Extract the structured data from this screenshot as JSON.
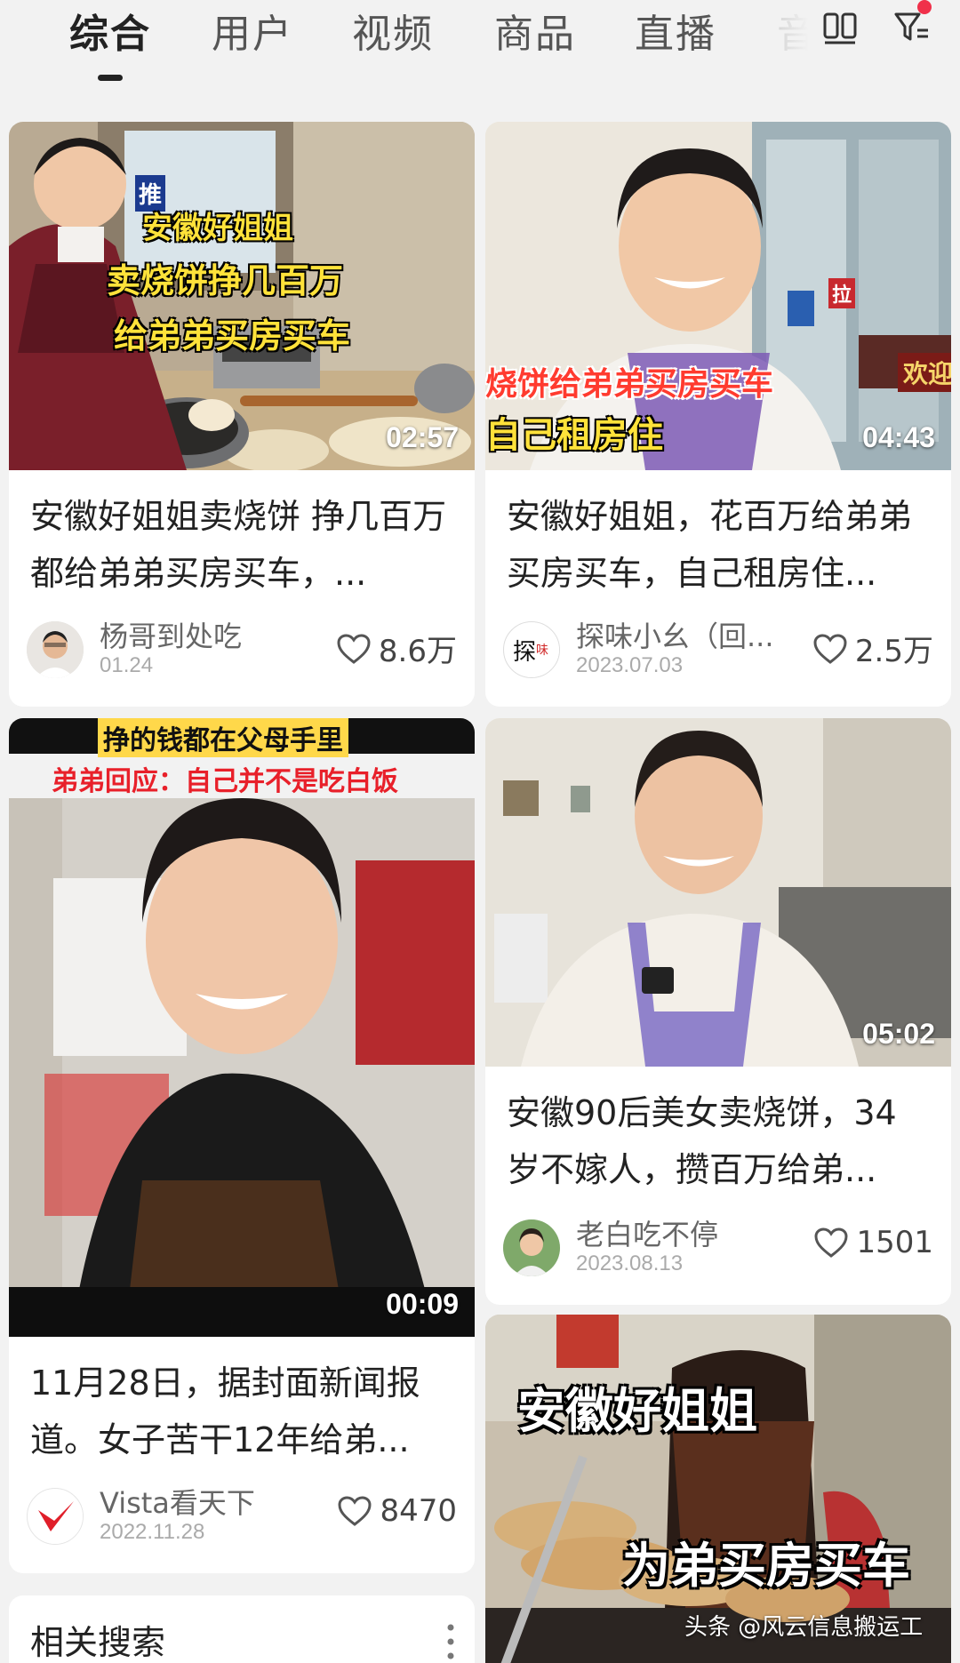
{
  "tabs": [
    {
      "label": "综合",
      "active": true
    },
    {
      "label": "用户",
      "active": false
    },
    {
      "label": "视频",
      "active": false
    },
    {
      "label": "商品",
      "active": false
    },
    {
      "label": "直播",
      "active": false
    },
    {
      "label": "音",
      "active": false
    }
  ],
  "icons": {
    "layout": "grid-layout-icon",
    "filter": "filter-icon",
    "like": "heart-icon",
    "more": "more-vertical-icon"
  },
  "colors": {
    "accent_red": "#f0304a",
    "caption_yellow": "#ffe23a",
    "caption_red": "#e8202a"
  },
  "cards": [
    {
      "duration": "02:57",
      "captions": [
        "推",
        "安徽好姐姐",
        "卖烧饼挣几百万",
        "给弟弟买房买车"
      ],
      "title": "安徽好姐姐卖烧饼 挣几百万都给弟弟买房买车，...",
      "author": "杨哥到处吃",
      "date": "01.24",
      "likes": "8.6万"
    },
    {
      "duration": "04:43",
      "captions": [
        "烧饼给弟弟买房买车",
        "自己租房住",
        "欢迎",
        "拉"
      ],
      "title": "安徽好姐姐，花百万给弟弟买房买车，自己租房住...",
      "author": "探味小幺（回...",
      "date": "2023.07.03",
      "likes": "2.5万"
    },
    {
      "duration": "00:09",
      "captions": [
        "挣的钱都在父母手里",
        "弟弟回应：自己并不是吃白饭"
      ],
      "title": "11月28日，据封面新闻报道。女子苦干12年给弟...",
      "author": "Vista看天下",
      "date": "2022.11.28",
      "likes": "8470"
    },
    {
      "duration": "05:02",
      "captions": [],
      "title": "安徽90后美女卖烧饼，34岁不嫁人，攒百万给弟...",
      "author": "老白吃不停",
      "date": "2023.08.13",
      "likes": "1501"
    },
    {
      "duration": "",
      "captions": [
        "安徽好姐姐",
        "为弟买房买车"
      ],
      "title": "",
      "author": "",
      "date": "",
      "likes": ""
    }
  ],
  "related": {
    "title": "相关搜索"
  },
  "watermark": "头条 @风云信息搬运工"
}
